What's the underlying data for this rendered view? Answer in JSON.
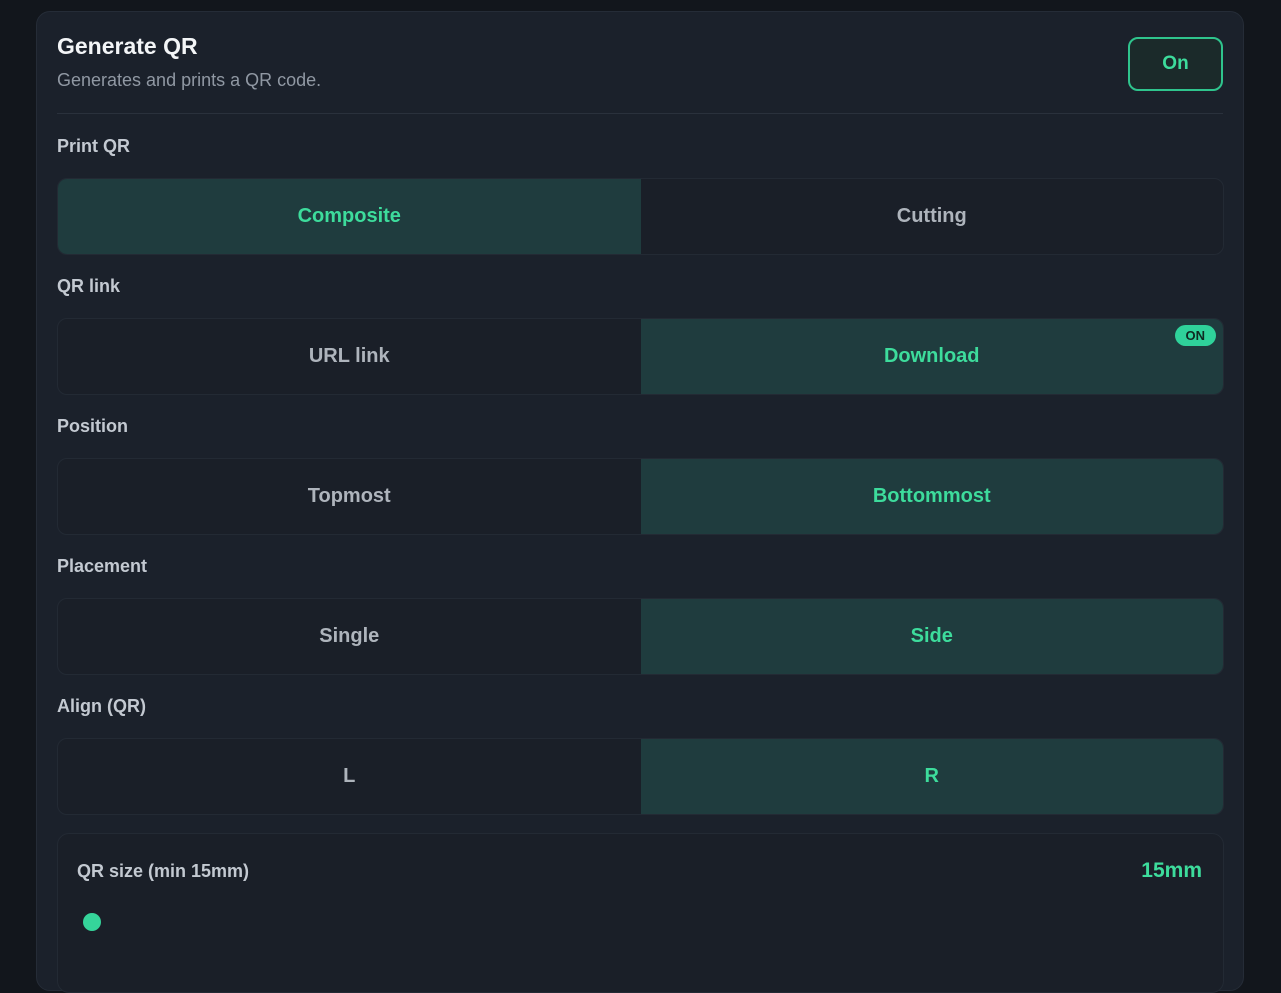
{
  "header": {
    "title": "Generate QR",
    "subtitle": "Generates and prints a QR code.",
    "toggle_label": "On"
  },
  "sections": {
    "print_qr": {
      "label": "Print QR",
      "options": [
        "Composite",
        "Cutting"
      ],
      "selected": "Composite"
    },
    "qr_link": {
      "label": "QR link",
      "options": [
        "URL link",
        "Download"
      ],
      "selected": "Download",
      "badge": "ON"
    },
    "position": {
      "label": "Position",
      "options": [
        "Topmost",
        "Bottommost"
      ],
      "selected": "Bottommost"
    },
    "placement": {
      "label": "Placement",
      "options": [
        "Single",
        "Side"
      ],
      "selected": "Side"
    },
    "align": {
      "label": "Align (QR)",
      "options": [
        "L",
        "R"
      ],
      "selected": "R"
    }
  },
  "qr_size": {
    "label": "QR size (min 15mm)",
    "value_text": "15mm",
    "slider_fraction": 0
  },
  "colors": {
    "accent": "#3ddc9c",
    "active_bg": "#1f3c3e",
    "panel_bg": "#1b212b",
    "page_bg": "#12161c"
  }
}
